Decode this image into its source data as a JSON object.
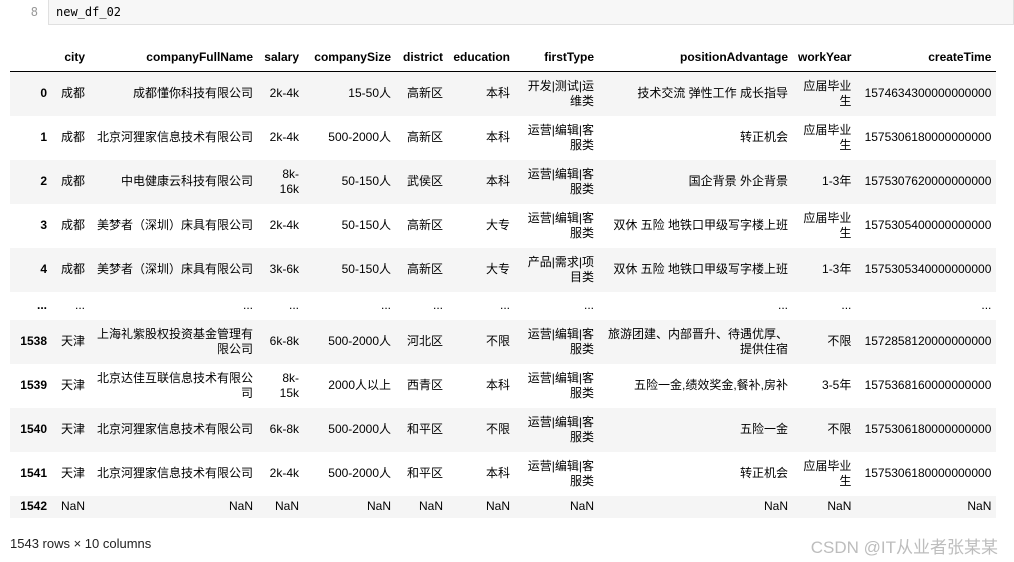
{
  "code_cell": {
    "line_number": "8",
    "code": "new_df_02"
  },
  "table": {
    "columns": [
      "city",
      "companyFullName",
      "salary",
      "companySize",
      "district",
      "education",
      "firstType",
      "positionAdvantage",
      "workYear",
      "createTime"
    ],
    "rows": [
      {
        "index": "0",
        "cells": [
          "成都",
          "成都懂你科技有限公司",
          "2k-4k",
          "15-50人",
          "高新区",
          "本科",
          "开发|测试|运维类",
          "技术交流 弹性工作 成长指导",
          "应届毕业生",
          "1574634300000000000"
        ]
      },
      {
        "index": "1",
        "cells": [
          "成都",
          "北京河狸家信息技术有限公司",
          "2k-4k",
          "500-2000人",
          "高新区",
          "本科",
          "运营|编辑|客服类",
          "转正机会",
          "应届毕业生",
          "1575306180000000000"
        ]
      },
      {
        "index": "2",
        "cells": [
          "成都",
          "中电健康云科技有限公司",
          "8k-16k",
          "50-150人",
          "武侯区",
          "本科",
          "运营|编辑|客服类",
          "国企背景 外企背景",
          "1-3年",
          "1575307620000000000"
        ]
      },
      {
        "index": "3",
        "cells": [
          "成都",
          "美梦者（深圳）床具有限公司",
          "2k-4k",
          "50-150人",
          "高新区",
          "大专",
          "运营|编辑|客服类",
          "双休 五险 地铁口甲级写字楼上班",
          "应届毕业生",
          "1575305400000000000"
        ]
      },
      {
        "index": "4",
        "cells": [
          "成都",
          "美梦者（深圳）床具有限公司",
          "3k-6k",
          "50-150人",
          "高新区",
          "大专",
          "产品|需求|项目类",
          "双休 五险 地铁口甲级写字楼上班",
          "1-3年",
          "1575305340000000000"
        ]
      },
      {
        "index": "...",
        "cells": [
          "...",
          "...",
          "...",
          "...",
          "...",
          "...",
          "...",
          "...",
          "...",
          "..."
        ],
        "ellipsis": true
      },
      {
        "index": "1538",
        "cells": [
          "天津",
          "上海礼紫股权投资基金管理有限公司",
          "6k-8k",
          "500-2000人",
          "河北区",
          "不限",
          "运营|编辑|客服类",
          "旅游团建、内部晋升、待遇优厚、提供住宿",
          "不限",
          "1572858120000000000"
        ]
      },
      {
        "index": "1539",
        "cells": [
          "天津",
          "北京达佳互联信息技术有限公司",
          "8k-15k",
          "2000人以上",
          "西青区",
          "本科",
          "运营|编辑|客服类",
          "五险一金,绩效奖金,餐补,房补",
          "3-5年",
          "1575368160000000000"
        ]
      },
      {
        "index": "1540",
        "cells": [
          "天津",
          "北京河狸家信息技术有限公司",
          "6k-8k",
          "500-2000人",
          "和平区",
          "不限",
          "运营|编辑|客服类",
          "五险一金",
          "不限",
          "1575306180000000000"
        ]
      },
      {
        "index": "1541",
        "cells": [
          "天津",
          "北京河狸家信息技术有限公司",
          "2k-4k",
          "500-2000人",
          "和平区",
          "本科",
          "运营|编辑|客服类",
          "转正机会",
          "应届毕业生",
          "1575306180000000000"
        ]
      },
      {
        "index": "1542",
        "cells": [
          "NaN",
          "NaN",
          "NaN",
          "NaN",
          "NaN",
          "NaN",
          "NaN",
          "NaN",
          "NaN",
          "NaN"
        ],
        "short": true
      }
    ]
  },
  "footer": {
    "shape_text": "1543 rows × 10 columns"
  },
  "watermark": {
    "text": "CSDN @IT从业者张某某"
  }
}
